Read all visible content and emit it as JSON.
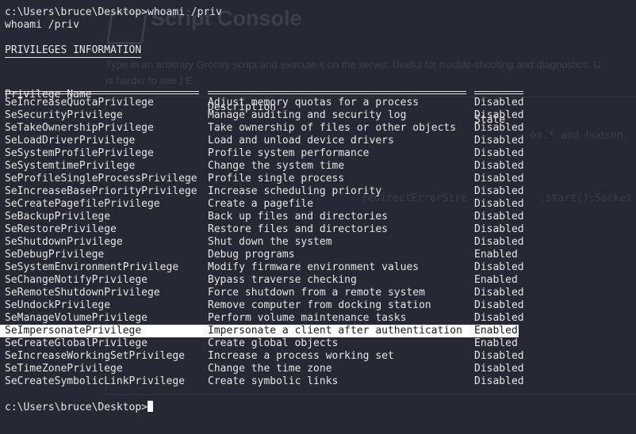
{
  "terminal": {
    "prompt": "c:\\Users\\bruce\\Desktop>",
    "command": "whoami /priv",
    "echo": "whoami /priv",
    "section_title": "PRIVILEGES INFORMATION",
    "columns": [
      "Privilege Name",
      "Description",
      "State"
    ],
    "rows": [
      {
        "name": "SeIncreaseQuotaPrivilege",
        "description": "Adjust memory quotas for a process",
        "state": "Disabled"
      },
      {
        "name": "SeSecurityPrivilege",
        "description": "Manage auditing and security log",
        "state": "Disabled"
      },
      {
        "name": "SeTakeOwnershipPrivilege",
        "description": "Take ownership of files or other objects",
        "state": "Disabled"
      },
      {
        "name": "SeLoadDriverPrivilege",
        "description": "Load and unload device drivers",
        "state": "Disabled"
      },
      {
        "name": "SeSystemProfilePrivilege",
        "description": "Profile system performance",
        "state": "Disabled"
      },
      {
        "name": "SeSystemtimePrivilege",
        "description": "Change the system time",
        "state": "Disabled"
      },
      {
        "name": "SeProfileSingleProcessPrivilege",
        "description": "Profile single process",
        "state": "Disabled"
      },
      {
        "name": "SeIncreaseBasePriorityPrivilege",
        "description": "Increase scheduling priority",
        "state": "Disabled"
      },
      {
        "name": "SeCreatePagefilePrivilege",
        "description": "Create a pagefile",
        "state": "Disabled"
      },
      {
        "name": "SeBackupPrivilege",
        "description": "Back up files and directories",
        "state": "Disabled"
      },
      {
        "name": "SeRestorePrivilege",
        "description": "Restore files and directories",
        "state": "Disabled"
      },
      {
        "name": "SeShutdownPrivilege",
        "description": "Shut down the system",
        "state": "Disabled"
      },
      {
        "name": "SeDebugPrivilege",
        "description": "Debug programs",
        "state": "Enabled"
      },
      {
        "name": "SeSystemEnvironmentPrivilege",
        "description": "Modify firmware environment values",
        "state": "Disabled"
      },
      {
        "name": "SeChangeNotifyPrivilege",
        "description": "Bypass traverse checking",
        "state": "Enabled"
      },
      {
        "name": "SeRemoteShutdownPrivilege",
        "description": "Force shutdown from a remote system",
        "state": "Disabled"
      },
      {
        "name": "SeUndockPrivilege",
        "description": "Remove computer from docking station",
        "state": "Disabled"
      },
      {
        "name": "SeManageVolumePrivilege",
        "description": "Perform volume maintenance tasks",
        "state": "Disabled"
      },
      {
        "name": "SeImpersonatePrivilege",
        "description": "Impersonate a client after authentication",
        "state": "Enabled",
        "highlighted": true
      },
      {
        "name": "SeCreateGlobalPrivilege",
        "description": "Create global objects",
        "state": "Enabled"
      },
      {
        "name": "SeIncreaseWorkingSetPrivilege",
        "description": "Increase a process working set",
        "state": "Disabled"
      },
      {
        "name": "SeTimeZonePrivilege",
        "description": "Change the time zone",
        "state": "Disabled"
      },
      {
        "name": "SeCreateSymbolicLinkPrivilege",
        "description": "Create symbolic links",
        "state": "Disabled"
      }
    ],
    "final_prompt": "c:\\Users\\bruce\\Desktop>"
  },
  "background_page": {
    "title": "Script Console",
    "intro_line1": "Type in an arbitrary Groovy script and execute it on the server. Useful for trouble-shooting and diagnostics. U",
    "intro_line2": "is harder to see.) E",
    "code_fragment1": "on.* and hudson.",
    "code_fragment2": "redirectErrorStre",
    "code_fragment3": ".start();Socket"
  },
  "colors": {
    "background": "#262833",
    "text": "#e6e6e6",
    "highlight_bg": "#ffffff",
    "highlight_text": "#1a1a1a"
  }
}
